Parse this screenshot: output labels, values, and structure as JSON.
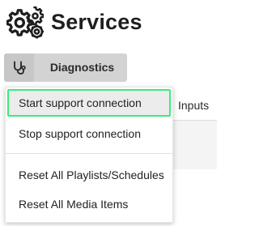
{
  "header": {
    "title": "Services",
    "icon": "gears-icon"
  },
  "toolbar": {
    "diagnostics_label": "Diagnostics",
    "diagnostics_icon": "stethoscope-icon"
  },
  "tabs": {
    "inputs_label": "Inputs"
  },
  "menu": {
    "items": [
      {
        "label": "Start support connection",
        "highlighted": true
      },
      {
        "label": "Stop support connection"
      },
      {
        "label": "Reset All Playlists/Schedules"
      },
      {
        "label": "Reset All Media Items"
      }
    ]
  },
  "colors": {
    "highlight_border": "#3ee87f",
    "button_bg": "#d3d3d3"
  }
}
